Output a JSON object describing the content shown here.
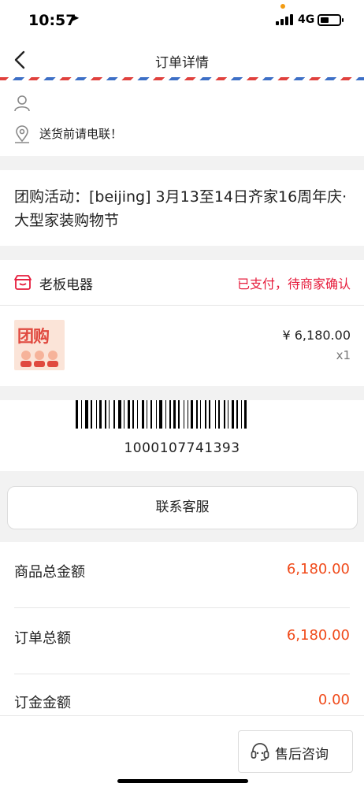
{
  "status_bar": {
    "time": "10:57",
    "network": "4G",
    "icons": [
      "location-arrow-icon",
      "signal-icon",
      "battery-icon"
    ]
  },
  "nav": {
    "title": "订单详情",
    "back_icon": "chevron-left-icon"
  },
  "address": {
    "user_icon": "user-icon",
    "pin_icon": "map-pin-icon",
    "note": "送货前请电联！"
  },
  "group_buy": {
    "text": "团购活动：[beijing] 3月13至14日齐家16周年庆·大型家装购物节"
  },
  "shop": {
    "icon": "store-icon",
    "name": "老板电器",
    "status": "已支付，待商家确认",
    "status_color": "#e61c3c",
    "product": {
      "thumb_text": "团购",
      "price": "¥  6,180.00",
      "qty": "x1"
    }
  },
  "barcode": {
    "number": "1000107741393"
  },
  "contact_button": "联系客服",
  "amounts": [
    {
      "label": "商品总金额",
      "value": "6,180.00"
    },
    {
      "label": "订单总额",
      "value": "6,180.00"
    },
    {
      "label": "订金金额",
      "value": "0.00"
    }
  ],
  "amount_color": "#f04a1a",
  "bottom": {
    "service_button": "售后咨询",
    "service_icon": "headset-icon"
  }
}
